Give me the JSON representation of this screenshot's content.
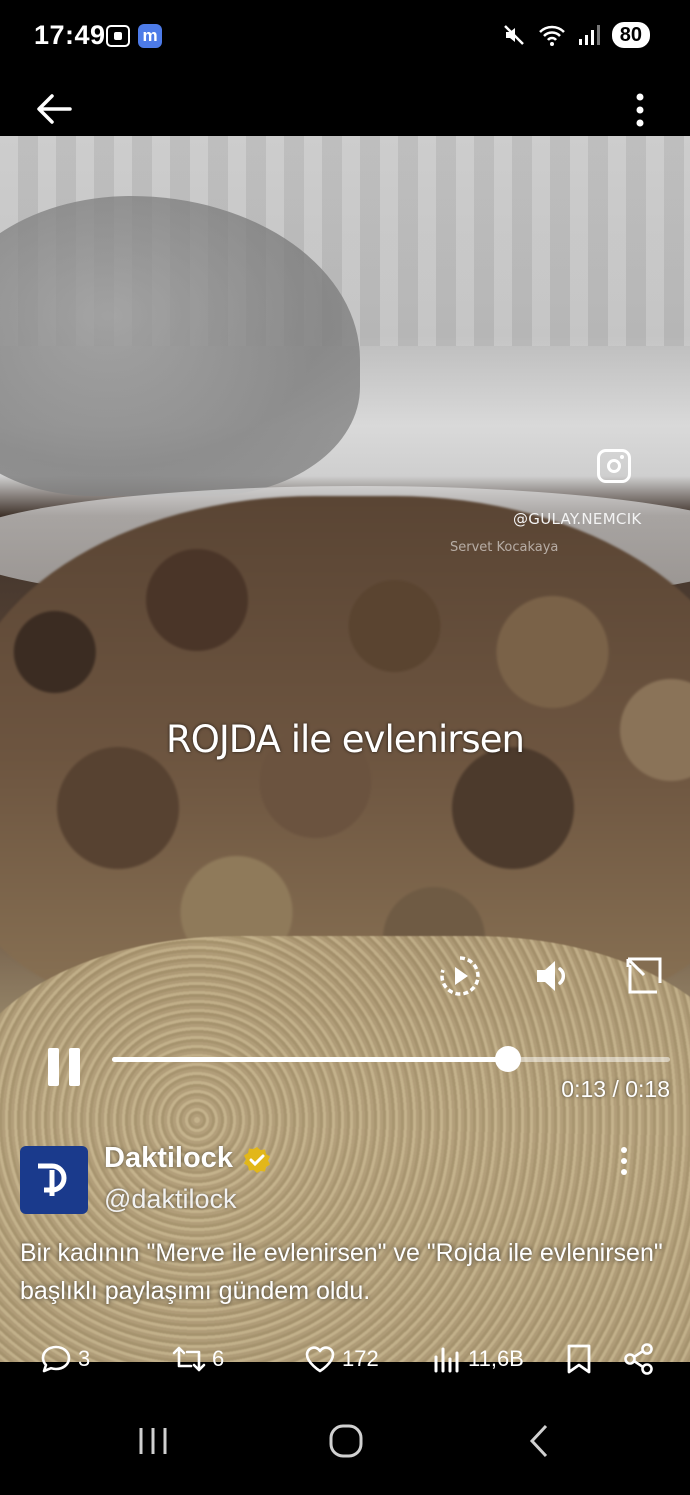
{
  "status": {
    "time": "17:49",
    "left_icons": [
      "screen-record-icon",
      "m-app-icon"
    ],
    "m_icon_text": "m",
    "right_icons": [
      "mute-icon",
      "wifi-icon",
      "signal-icon"
    ],
    "battery": "80"
  },
  "video": {
    "caption": "ROJDA ile evlenirsen",
    "watermark": "@GULAY.NEMCIK",
    "watermark_secondary": "Servet Kocakaya",
    "time_readout": "0:13 / 0:18",
    "progress": 0.71
  },
  "post": {
    "avatar_text": "D",
    "author_name": "Daktilock",
    "handle": "@daktilock",
    "text": "Bir kadının \"Merve ile evlenirsen\" ve \"Rojda ile evlenirsen\" başlıklı paylaşımı gündem oldu.",
    "verified_color": "#e2b719"
  },
  "actions": {
    "replies": "3",
    "reposts": "6",
    "likes": "172",
    "views": "11,6B"
  }
}
